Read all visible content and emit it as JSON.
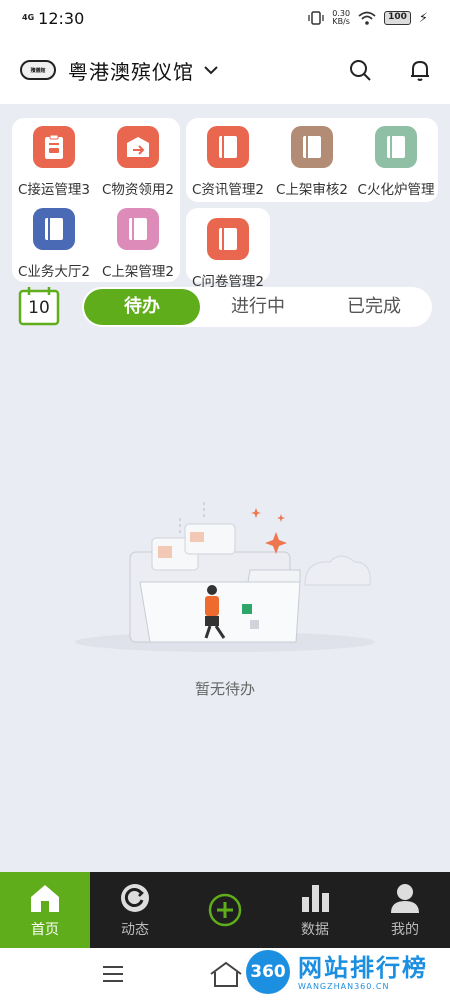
{
  "status_bar": {
    "network": "4G",
    "time": "12:30",
    "speed_value": "0.30",
    "speed_unit": "KB/s",
    "battery": "100"
  },
  "header": {
    "logo_text": "殯儀館",
    "title": "粤港澳殡仪馆"
  },
  "apps": [
    {
      "label": "C接运管理3",
      "color": "#e8674e"
    },
    {
      "label": "C物资领用2",
      "color": "#e8674e"
    },
    {
      "label": "C资讯管理2",
      "color": "#e8674e"
    },
    {
      "label": "C上架审核2",
      "color": "#b38c76"
    },
    {
      "label": "C火化炉管理",
      "color": "#8fbfa5"
    },
    {
      "label": "C业务大厅2",
      "color": "#4a6ab5"
    },
    {
      "label": "C上架管理2",
      "color": "#dd8bb8"
    },
    {
      "label": "C问卷管理2",
      "color": "#e8674e"
    }
  ],
  "calendar": {
    "day": "10"
  },
  "tabs": [
    {
      "label": "待办"
    },
    {
      "label": "进行中"
    },
    {
      "label": "已完成"
    }
  ],
  "empty_state": {
    "text": "暂无待办"
  },
  "bottom_nav": [
    {
      "label": "首页"
    },
    {
      "label": "动态"
    },
    {
      "label": ""
    },
    {
      "label": "数据"
    },
    {
      "label": "我的"
    }
  ],
  "watermark": {
    "logo": "360",
    "main": "网站排行榜",
    "sub": "WANGZHAN360.CN"
  },
  "colors": {
    "accent": "#5fad1a",
    "nav_bg": "#1f1f1f",
    "page_bg": "#e9ecf2"
  }
}
